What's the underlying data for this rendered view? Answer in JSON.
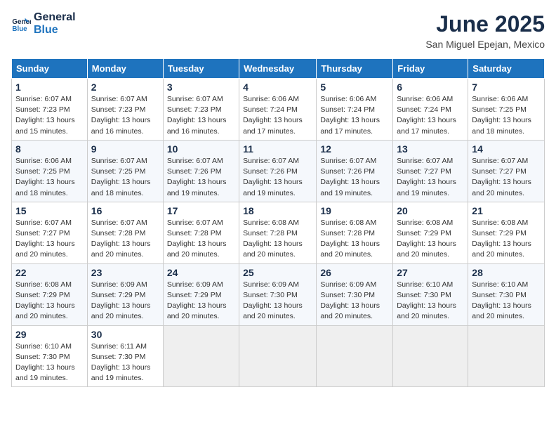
{
  "logo": {
    "line1": "General",
    "line2": "Blue"
  },
  "title": "June 2025",
  "location": "San Miguel Epejan, Mexico",
  "days_of_week": [
    "Sunday",
    "Monday",
    "Tuesday",
    "Wednesday",
    "Thursday",
    "Friday",
    "Saturday"
  ],
  "weeks": [
    [
      {
        "day": "1",
        "sunrise": "6:07 AM",
        "sunset": "7:23 PM",
        "daylight": "13 hours and 15 minutes."
      },
      {
        "day": "2",
        "sunrise": "6:07 AM",
        "sunset": "7:23 PM",
        "daylight": "13 hours and 16 minutes."
      },
      {
        "day": "3",
        "sunrise": "6:07 AM",
        "sunset": "7:23 PM",
        "daylight": "13 hours and 16 minutes."
      },
      {
        "day": "4",
        "sunrise": "6:06 AM",
        "sunset": "7:24 PM",
        "daylight": "13 hours and 17 minutes."
      },
      {
        "day": "5",
        "sunrise": "6:06 AM",
        "sunset": "7:24 PM",
        "daylight": "13 hours and 17 minutes."
      },
      {
        "day": "6",
        "sunrise": "6:06 AM",
        "sunset": "7:24 PM",
        "daylight": "13 hours and 17 minutes."
      },
      {
        "day": "7",
        "sunrise": "6:06 AM",
        "sunset": "7:25 PM",
        "daylight": "13 hours and 18 minutes."
      }
    ],
    [
      {
        "day": "8",
        "sunrise": "6:06 AM",
        "sunset": "7:25 PM",
        "daylight": "13 hours and 18 minutes."
      },
      {
        "day": "9",
        "sunrise": "6:07 AM",
        "sunset": "7:25 PM",
        "daylight": "13 hours and 18 minutes."
      },
      {
        "day": "10",
        "sunrise": "6:07 AM",
        "sunset": "7:26 PM",
        "daylight": "13 hours and 19 minutes."
      },
      {
        "day": "11",
        "sunrise": "6:07 AM",
        "sunset": "7:26 PM",
        "daylight": "13 hours and 19 minutes."
      },
      {
        "day": "12",
        "sunrise": "6:07 AM",
        "sunset": "7:26 PM",
        "daylight": "13 hours and 19 minutes."
      },
      {
        "day": "13",
        "sunrise": "6:07 AM",
        "sunset": "7:27 PM",
        "daylight": "13 hours and 19 minutes."
      },
      {
        "day": "14",
        "sunrise": "6:07 AM",
        "sunset": "7:27 PM",
        "daylight": "13 hours and 20 minutes."
      }
    ],
    [
      {
        "day": "15",
        "sunrise": "6:07 AM",
        "sunset": "7:27 PM",
        "daylight": "13 hours and 20 minutes."
      },
      {
        "day": "16",
        "sunrise": "6:07 AM",
        "sunset": "7:28 PM",
        "daylight": "13 hours and 20 minutes."
      },
      {
        "day": "17",
        "sunrise": "6:07 AM",
        "sunset": "7:28 PM",
        "daylight": "13 hours and 20 minutes."
      },
      {
        "day": "18",
        "sunrise": "6:08 AM",
        "sunset": "7:28 PM",
        "daylight": "13 hours and 20 minutes."
      },
      {
        "day": "19",
        "sunrise": "6:08 AM",
        "sunset": "7:28 PM",
        "daylight": "13 hours and 20 minutes."
      },
      {
        "day": "20",
        "sunrise": "6:08 AM",
        "sunset": "7:29 PM",
        "daylight": "13 hours and 20 minutes."
      },
      {
        "day": "21",
        "sunrise": "6:08 AM",
        "sunset": "7:29 PM",
        "daylight": "13 hours and 20 minutes."
      }
    ],
    [
      {
        "day": "22",
        "sunrise": "6:08 AM",
        "sunset": "7:29 PM",
        "daylight": "13 hours and 20 minutes."
      },
      {
        "day": "23",
        "sunrise": "6:09 AM",
        "sunset": "7:29 PM",
        "daylight": "13 hours and 20 minutes."
      },
      {
        "day": "24",
        "sunrise": "6:09 AM",
        "sunset": "7:29 PM",
        "daylight": "13 hours and 20 minutes."
      },
      {
        "day": "25",
        "sunrise": "6:09 AM",
        "sunset": "7:30 PM",
        "daylight": "13 hours and 20 minutes."
      },
      {
        "day": "26",
        "sunrise": "6:09 AM",
        "sunset": "7:30 PM",
        "daylight": "13 hours and 20 minutes."
      },
      {
        "day": "27",
        "sunrise": "6:10 AM",
        "sunset": "7:30 PM",
        "daylight": "13 hours and 20 minutes."
      },
      {
        "day": "28",
        "sunrise": "6:10 AM",
        "sunset": "7:30 PM",
        "daylight": "13 hours and 20 minutes."
      }
    ],
    [
      {
        "day": "29",
        "sunrise": "6:10 AM",
        "sunset": "7:30 PM",
        "daylight": "13 hours and 19 minutes."
      },
      {
        "day": "30",
        "sunrise": "6:11 AM",
        "sunset": "7:30 PM",
        "daylight": "13 hours and 19 minutes."
      },
      null,
      null,
      null,
      null,
      null
    ]
  ],
  "labels": {
    "sunrise": "Sunrise:",
    "sunset": "Sunset:",
    "daylight": "Daylight:"
  }
}
